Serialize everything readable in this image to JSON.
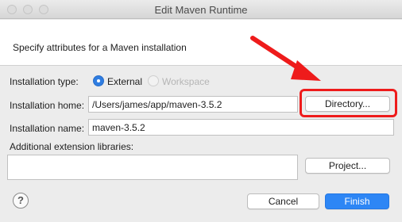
{
  "window": {
    "title": "Edit Maven Runtime"
  },
  "header": {
    "description": "Specify attributes for a Maven installation"
  },
  "installation_type": {
    "label": "Installation type:",
    "options": [
      {
        "label": "External",
        "selected": true
      },
      {
        "label": "Workspace",
        "selected": false
      }
    ]
  },
  "installation_home": {
    "label": "Installation home:",
    "value": "/Users/james/app/maven-3.5.2",
    "button_label": "Directory..."
  },
  "installation_name": {
    "label": "Installation name:",
    "value": "maven-3.5.2"
  },
  "extensions": {
    "label": "Additional extension libraries:",
    "project_button": "Project..."
  },
  "footer": {
    "help_glyph": "?",
    "cancel_label": "Cancel",
    "finish_label": "Finish"
  },
  "colors": {
    "accent": "#2d86f5",
    "annotation": "#ee1b1b"
  }
}
